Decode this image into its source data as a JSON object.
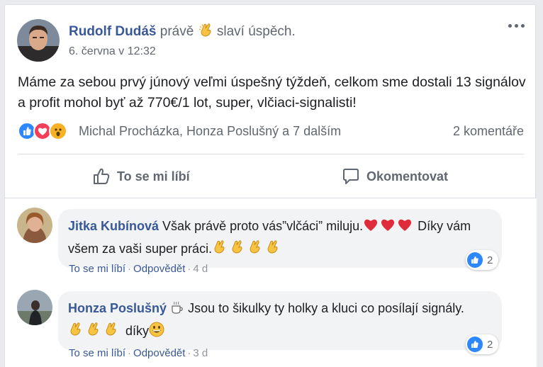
{
  "post": {
    "author": "Rudolf Dudáš",
    "activity_prefix": "právě",
    "activity": "slaví úspěch.",
    "timestamp": "6. června v 12:32",
    "text": "Máme za sebou prvý júnový veľmi úspešný týždeň, celkom sme dostali 13 signálov a profit mohol byť až 770€/1 lot, super, vlčiaci-signalisti!",
    "reactors": "Michal Procházka, Honza Poslušný a 7 dalším",
    "comment_count": "2 komentáře"
  },
  "actions": {
    "like": "To se mi líbí",
    "comment": "Okomentovat"
  },
  "comments": [
    {
      "author": "Jitka Kubínová",
      "text_part1": "Však právě proto vás”vlčáci” miluju.",
      "text_part2": "Díky vám všem za vaši super práci.",
      "like_label": "To se mi líbí",
      "reply_label": "Odpovědět",
      "age": "4 d",
      "reaction_count": "2"
    },
    {
      "author": "Honza Poslušný",
      "text_part1": "Jsou to šikulky ty holky a kluci co posílají signály.",
      "text_part2": "díky",
      "like_label": "To se mi líbí",
      "reply_label": "Odpovědět",
      "age": "3 d",
      "reaction_count": "2"
    }
  ],
  "colors": {
    "link": "#385898",
    "like_blue": "#2d88ff",
    "love_red": "#f33e58",
    "wow_yellow": "#f7b125",
    "bubble": "#f2f3f5"
  },
  "icons": [
    "clapping-hands-icon",
    "like-reaction-icon",
    "love-reaction-icon",
    "wow-reaction-icon",
    "thumbs-up-icon",
    "speech-bubble-icon",
    "heart-icon",
    "grinning-face-icon",
    "coffee-icon",
    "more-options-icon"
  ]
}
